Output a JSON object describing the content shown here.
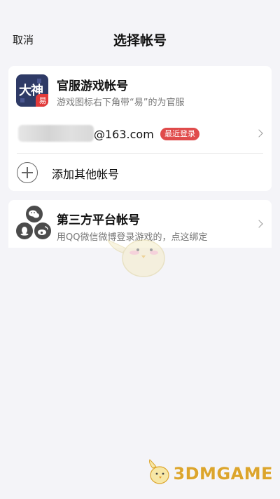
{
  "nav": {
    "cancel_label": "取消",
    "title": "选择帐号"
  },
  "official": {
    "icon_name": "game-app-icon",
    "icon_text": "大神",
    "icon_badge": "易",
    "title": "官服游戏帐号",
    "subtitle": "游戏图标右下角带“易”的为官服",
    "account": {
      "domain": "@163.com",
      "recent_badge": "最近登录"
    },
    "add_label": "添加其他帐号"
  },
  "third_party": {
    "icon_name": "social-platforms-icon",
    "title": "第三方平台帐号",
    "subtitle": "用QQ微信微博登录游戏的，点这绑定"
  },
  "watermark": {
    "text": "3DMGAME"
  },
  "colors": {
    "background": "#f4f4f8",
    "card": "#ffffff",
    "badge_red": "#e04b4b",
    "watermark_gold": "#dca52c",
    "game_icon_navy": "#2e3a66"
  }
}
